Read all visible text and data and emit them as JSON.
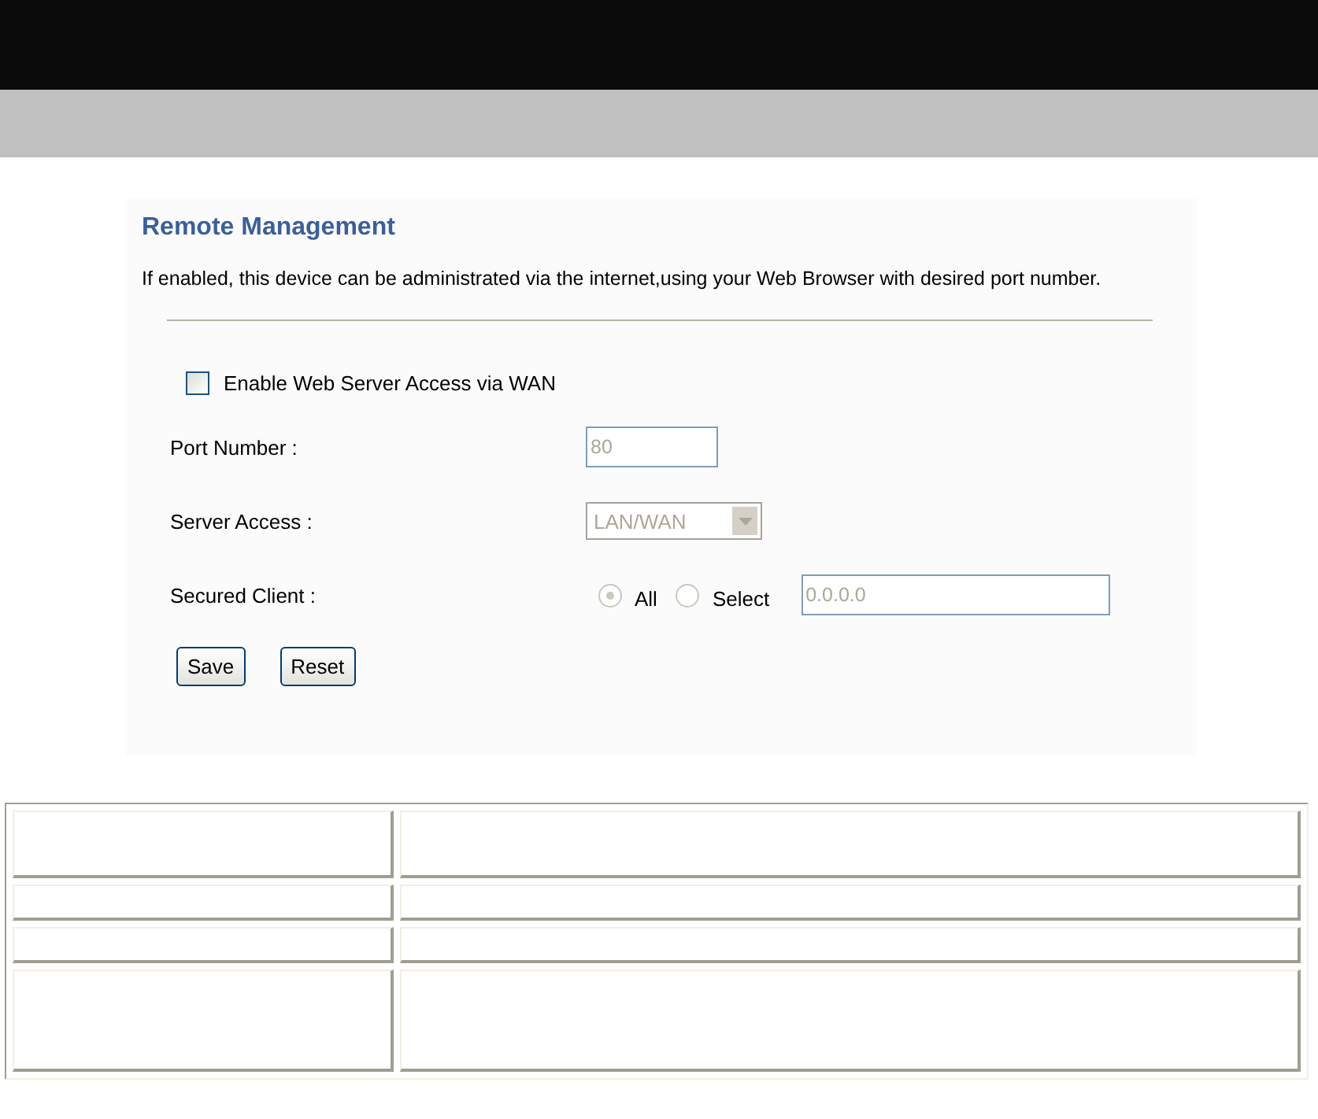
{
  "section": {
    "title": "Remote Management",
    "description": "If enabled, this device can be administrated via the internet,using your Web Browser with desired port number."
  },
  "enable": {
    "label": "Enable Web Server Access via WAN",
    "checked": false
  },
  "fields": [
    {
      "kind": "text",
      "label": "Port Number :",
      "value": "80",
      "disabled": true
    },
    {
      "kind": "select",
      "label": "Server Access :",
      "value": "LAN/WAN",
      "disabled": true
    },
    {
      "kind": "radio",
      "label": "Secured Client :",
      "disabled": true,
      "options": [
        {
          "label": "All",
          "selected": true
        },
        {
          "label": "Select",
          "selected": false
        }
      ],
      "value": "0.0.0.0"
    }
  ],
  "buttons": [
    "Save",
    "Reset"
  ]
}
